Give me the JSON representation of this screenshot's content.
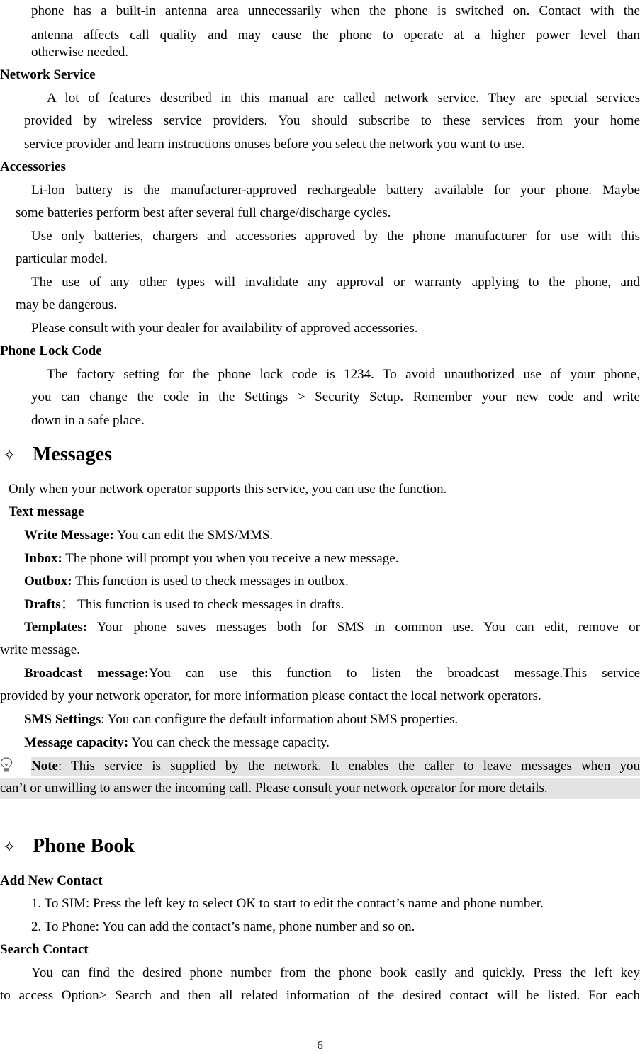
{
  "intro": {
    "lines": [
      "phone has a built-in antenna area unnecessarily when the phone is switched on. Contact with the",
      "antenna affects call quality and may cause the phone to operate at a higher power level than",
      "otherwise needed."
    ]
  },
  "network_service": {
    "heading": "Network Service",
    "lines": [
      "A lot of features described in this manual are called network service. They are special services",
      "provided by wireless service providers. You should subscribe to these services from your home",
      "service provider and learn instructions onuses before you select the network you want to use."
    ]
  },
  "accessories": {
    "heading": "Accessories",
    "lines": [
      "Li-lon battery is the manufacturer-approved rechargeable battery available for your phone. Maybe",
      "some batteries perform best after several full charge/discharge cycles.",
      "Use only batteries, chargers and accessories approved by the phone manufacturer for use with this",
      "particular model.",
      "The use of any other types will invalidate any approval or warranty applying to the phone, and",
      "may be dangerous.",
      "Please consult with your dealer for availability of approved accessories."
    ]
  },
  "phone_lock": {
    "heading": "Phone Lock Code",
    "lines": [
      "The factory setting for the phone lock code is 1234. To avoid unauthorized use of your phone,",
      "you can change the code in the Settings > Security Setup. Remember your new code and write",
      "down in a safe place."
    ]
  },
  "messages": {
    "icon": "diamond-outline-icon",
    "title": "Messages",
    "intro": "Only when your network operator supports this service, you can use the function.",
    "subheading": "Text message",
    "items": [
      {
        "label": "Write Message:",
        "text": " You can edit the SMS/MMS."
      },
      {
        "label": "Inbox:",
        "text": " The phone will prompt you when you receive a new message."
      },
      {
        "label": "Outbox:",
        "text": " This function is used to check messages in outbox."
      },
      {
        "label": "Drafts",
        "text": "： This function is used to check messages in drafts."
      },
      {
        "label": "Templates:",
        "text": " Your phone saves messages both for SMS in common use. You can edit, remove or",
        "cont": "write message."
      },
      {
        "label": "Broadcast message:",
        "text": "You can use this function to listen the broadcast message.This service",
        "cont": "provided by your network operator, for more information please contact the local network operators."
      },
      {
        "label": "SMS Settings",
        "text": ": You can configure the default information about SMS properties."
      },
      {
        "label": "Message capacity:",
        "text": " You can check the message capacity."
      }
    ],
    "note": {
      "icon": "lightbulb-icon",
      "label": "Note",
      "line1": ": This service is supplied by the network. It enables the caller to leave messages when you",
      "line2": "can’t or unwilling to answer the incoming call. Please consult your network operator for more details."
    }
  },
  "phone_book": {
    "icon": "diamond-outline-icon",
    "title": "Phone Book",
    "add_heading": "Add New Contact",
    "add_lines": [
      "1. To SIM: Press the left key to select OK to start to edit the contact’s name and phone number.",
      "2. To Phone: You can add the contact’s name, phone number and so on."
    ],
    "search_heading": "Search Contact",
    "search_lines": [
      "You can find the desired phone number from the phone book easily and quickly. Press the left key",
      "to access Option> Search and then all related information of the desired contact will be listed. For each"
    ]
  },
  "footer": {
    "page_number": "6"
  },
  "colors": {
    "note_shade": "#e3e3e3",
    "text": "#000000"
  }
}
